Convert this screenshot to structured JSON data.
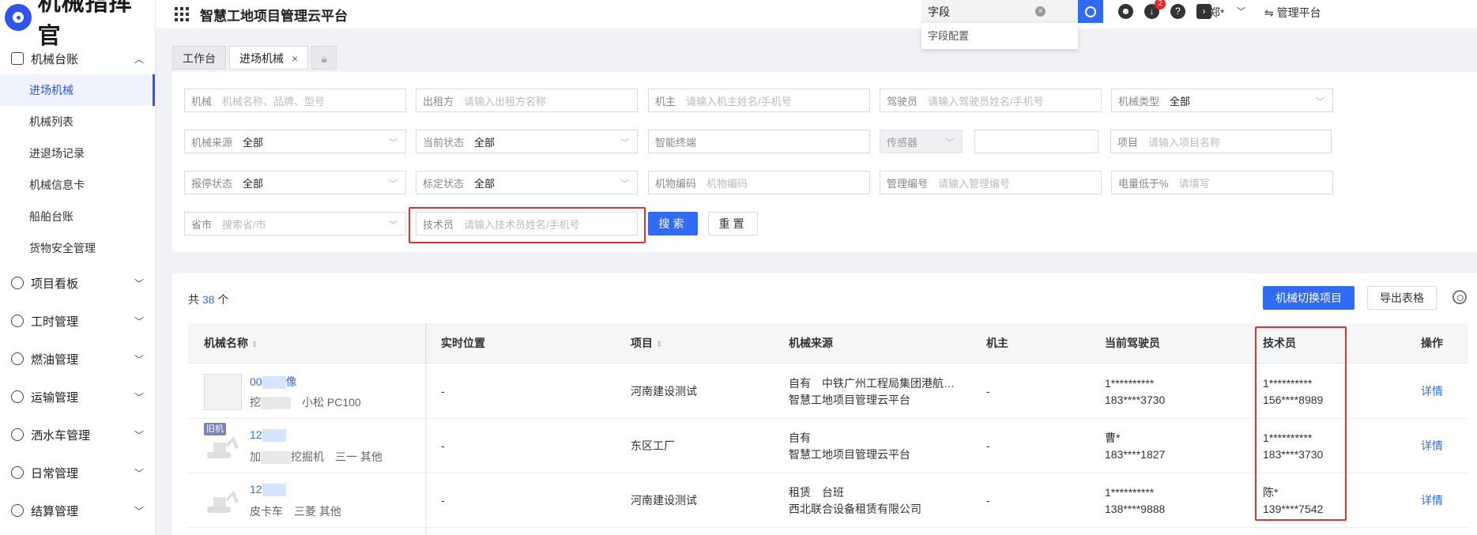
{
  "app": {
    "logo_text": "机械指挥官",
    "title": "智慧工地项目管理云平台"
  },
  "header": {
    "search_value": "字段",
    "search_suggestion": "字段配置",
    "notification_count": "2",
    "user_name": "郑*",
    "manage_label": "管理平台"
  },
  "sidebar": {
    "group1": "机械台账",
    "items": [
      "进场机械",
      "机械列表",
      "进退场记录",
      "机械信息卡",
      "船舶台账",
      "货物安全管理"
    ],
    "groups": [
      "项目看板",
      "工时管理",
      "燃油管理",
      "运输管理",
      "洒水车管理",
      "日常管理",
      "结算管理"
    ]
  },
  "tabs": {
    "workbench": "工作台",
    "entry": "进场机械"
  },
  "filters": {
    "machine": {
      "label": "机械",
      "placeholder": "机械名称、品牌、型号"
    },
    "lessor": {
      "label": "出租方",
      "placeholder": "请输入出租方名称"
    },
    "owner": {
      "label": "机主",
      "placeholder": "请输入机主姓名/手机号"
    },
    "driver": {
      "label": "驾驶员",
      "placeholder": "请输入驾驶员姓名/手机号"
    },
    "type": {
      "label": "机械类型",
      "value": "全部"
    },
    "source": {
      "label": "机械来源",
      "value": "全部"
    },
    "status": {
      "label": "当前状态",
      "value": "全部"
    },
    "terminal": {
      "label": "智能终端"
    },
    "sensor": {
      "label": "传感器"
    },
    "project": {
      "label": "项目",
      "placeholder": "请输入项目名称"
    },
    "repair": {
      "label": "报停状态",
      "value": "全部"
    },
    "calib": {
      "label": "标定状态",
      "value": "全部"
    },
    "code": {
      "label": "机物编码",
      "placeholder": "机物编码"
    },
    "mgmt": {
      "label": "管理编号",
      "placeholder": "请输入管理编号"
    },
    "battery": {
      "label": "电量低于%",
      "placeholder": "请填写"
    },
    "province": {
      "label": "省市",
      "placeholder": "搜索省/市"
    },
    "tech": {
      "label": "技术员",
      "placeholder": "请输入技术员姓名/手机号"
    },
    "search_btn": "搜索",
    "reset_btn": "重置"
  },
  "table": {
    "total_prefix": "共",
    "total": "38",
    "total_suffix": "个",
    "switch_btn": "机械切换项目",
    "export_btn": "导出表格",
    "columns": [
      "机械名称",
      "实时位置",
      "项目",
      "机械来源",
      "机主",
      "当前驾驶员",
      "技术员",
      "操作"
    ],
    "rows": [
      {
        "name": "00",
        "name_tail": "像",
        "sub_head": "挖",
        "sub_tail": "小松 PC100",
        "location": "-",
        "project": "河南建设测试",
        "source1": "自有　中铁广州工程局集团港航…",
        "source2": "智慧工地项目管理云平台",
        "owner": "-",
        "driver1": "1**********",
        "driver2": "183****3730",
        "tech1": "1**********",
        "tech2": "156****8989",
        "action": "详情",
        "old": ""
      },
      {
        "name": "12",
        "name_tail": "",
        "sub_head": "加",
        "sub_tail": "挖掘机　三一 其他",
        "location": "-",
        "project": "东区工厂",
        "source1": "自有",
        "source2": "智慧工地项目管理云平台",
        "owner": "-",
        "driver1": "曹*",
        "driver2": "183****1827",
        "tech1": "1**********",
        "tech2": "183****3730",
        "action": "详情",
        "old": "旧机"
      },
      {
        "name": "12",
        "name_tail": "",
        "sub_head": "皮卡车　三菱 其他",
        "sub_tail": "",
        "location": "-",
        "project": "河南建设测试",
        "source1": "租赁　台班",
        "source2": "西北联合设备租赁有限公司",
        "owner": "-",
        "driver1": "1**********",
        "driver2": "138****9888",
        "tech1": "陈*",
        "tech2": "139****7542",
        "action": "详情",
        "old": ""
      }
    ]
  },
  "colors": {
    "accent": "#2f6bf5",
    "highlight": "#e0332e"
  }
}
